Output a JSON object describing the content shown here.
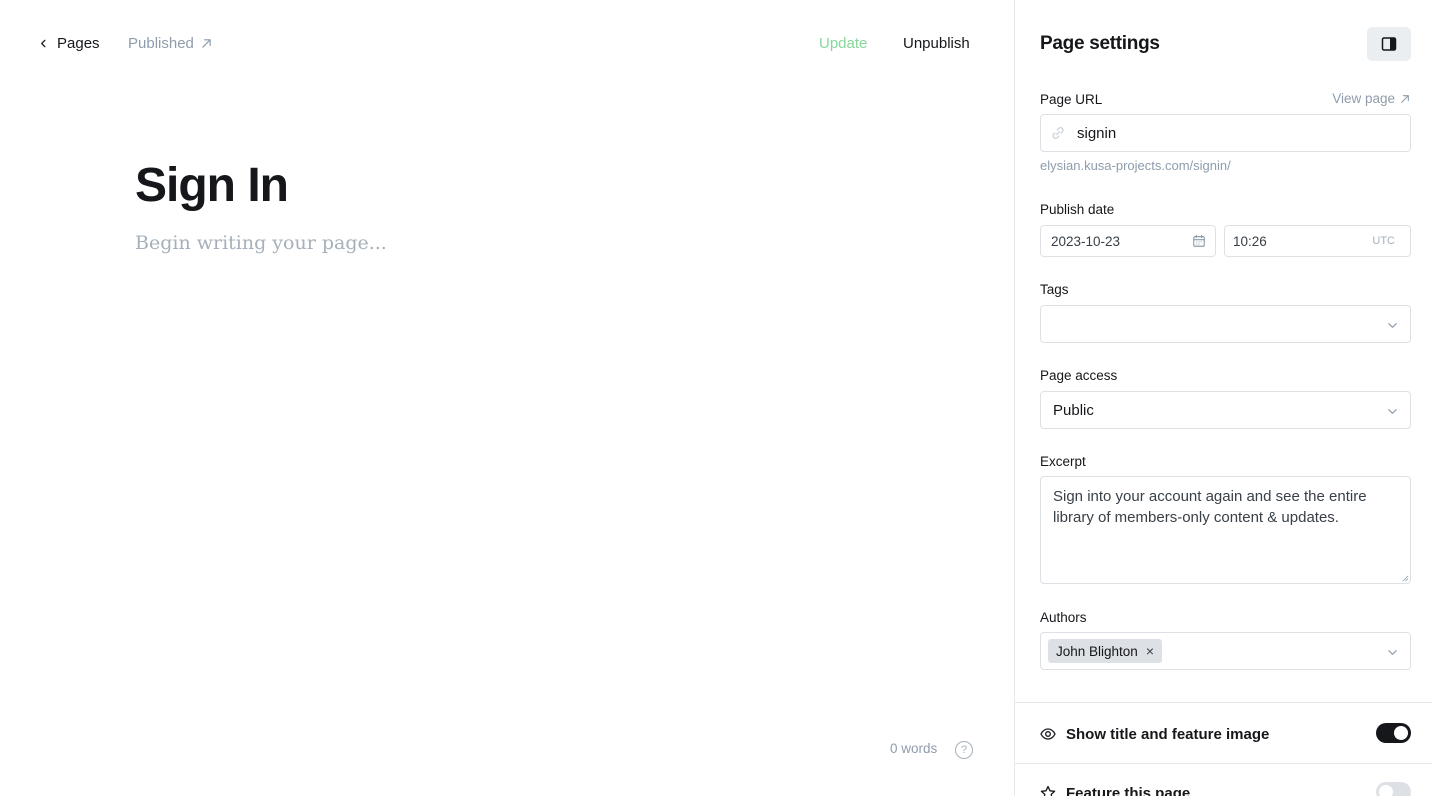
{
  "topbar": {
    "back_label": "Pages",
    "status_label": "Published",
    "update_label": "Update",
    "unpublish_label": "Unpublish"
  },
  "editor": {
    "title": "Sign In",
    "body_placeholder": "Begin writing your page...",
    "word_count": "0 words",
    "help_label": "?"
  },
  "settings": {
    "title": "Page settings",
    "page_url": {
      "label": "Page URL",
      "view_page_label": "View page",
      "value": "signin",
      "hint": "elysian.kusa-projects.com/signin/"
    },
    "publish_date": {
      "label": "Publish date",
      "date": "2023-10-23",
      "time": "10:26",
      "timezone": "UTC"
    },
    "tags": {
      "label": "Tags",
      "value": ""
    },
    "page_access": {
      "label": "Page access",
      "value": "Public"
    },
    "excerpt": {
      "label": "Excerpt",
      "value": "Sign into your account again and see the entire library of members-only content & updates."
    },
    "authors": {
      "label": "Authors",
      "items": [
        "John Blighton"
      ],
      "remove_glyph": "×"
    },
    "toggles": [
      {
        "label": "Show title and feature image",
        "icon": "eye-icon",
        "on": true
      },
      {
        "label": "Feature this page",
        "icon": "star-icon",
        "on": false
      }
    ]
  },
  "colors": {
    "accent_update": "#87d79b",
    "text_primary": "#15171a",
    "text_muted": "#8e9cac",
    "border": "#dde1e5"
  }
}
